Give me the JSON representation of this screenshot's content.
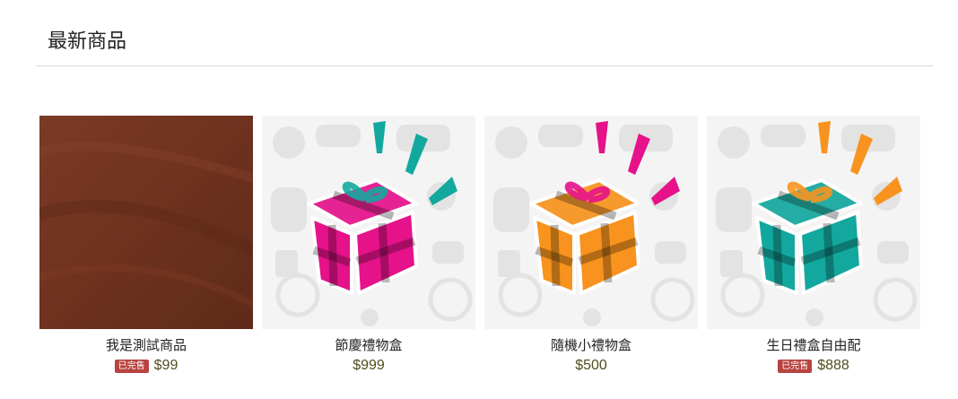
{
  "section": {
    "title": "最新商品"
  },
  "products": [
    {
      "name": "我是測試商品",
      "price": "$99",
      "sold_out_label": "已完售",
      "image": "brown-texture-photo"
    },
    {
      "name": "節慶禮物盒",
      "price": "$999",
      "image": "gift-box-pink",
      "box_color": "#e5128a",
      "burst_color": "#13a89e"
    },
    {
      "name": "隨機小禮物盒",
      "price": "$500",
      "image": "gift-box-orange",
      "box_color": "#f7931e",
      "burst_color": "#e5128a"
    },
    {
      "name": "生日禮盒自由配",
      "price": "$888",
      "sold_out_label": "已完售",
      "image": "gift-box-teal",
      "box_color": "#13a89e",
      "burst_color": "#f7931e"
    }
  ],
  "colors": {
    "sold_badge": "#b8433f",
    "price_text": "#4d4d1d"
  }
}
